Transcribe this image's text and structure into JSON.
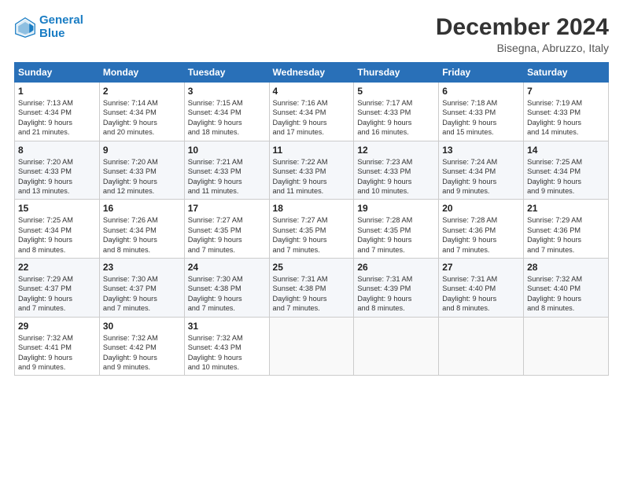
{
  "header": {
    "logo_line1": "General",
    "logo_line2": "Blue",
    "month": "December 2024",
    "location": "Bisegna, Abruzzo, Italy"
  },
  "weekdays": [
    "Sunday",
    "Monday",
    "Tuesday",
    "Wednesday",
    "Thursday",
    "Friday",
    "Saturday"
  ],
  "weeks": [
    [
      {
        "day": "1",
        "info": "Sunrise: 7:13 AM\nSunset: 4:34 PM\nDaylight: 9 hours\nand 21 minutes."
      },
      {
        "day": "2",
        "info": "Sunrise: 7:14 AM\nSunset: 4:34 PM\nDaylight: 9 hours\nand 20 minutes."
      },
      {
        "day": "3",
        "info": "Sunrise: 7:15 AM\nSunset: 4:34 PM\nDaylight: 9 hours\nand 18 minutes."
      },
      {
        "day": "4",
        "info": "Sunrise: 7:16 AM\nSunset: 4:34 PM\nDaylight: 9 hours\nand 17 minutes."
      },
      {
        "day": "5",
        "info": "Sunrise: 7:17 AM\nSunset: 4:33 PM\nDaylight: 9 hours\nand 16 minutes."
      },
      {
        "day": "6",
        "info": "Sunrise: 7:18 AM\nSunset: 4:33 PM\nDaylight: 9 hours\nand 15 minutes."
      },
      {
        "day": "7",
        "info": "Sunrise: 7:19 AM\nSunset: 4:33 PM\nDaylight: 9 hours\nand 14 minutes."
      }
    ],
    [
      {
        "day": "8",
        "info": "Sunrise: 7:20 AM\nSunset: 4:33 PM\nDaylight: 9 hours\nand 13 minutes."
      },
      {
        "day": "9",
        "info": "Sunrise: 7:20 AM\nSunset: 4:33 PM\nDaylight: 9 hours\nand 12 minutes."
      },
      {
        "day": "10",
        "info": "Sunrise: 7:21 AM\nSunset: 4:33 PM\nDaylight: 9 hours\nand 11 minutes."
      },
      {
        "day": "11",
        "info": "Sunrise: 7:22 AM\nSunset: 4:33 PM\nDaylight: 9 hours\nand 11 minutes."
      },
      {
        "day": "12",
        "info": "Sunrise: 7:23 AM\nSunset: 4:33 PM\nDaylight: 9 hours\nand 10 minutes."
      },
      {
        "day": "13",
        "info": "Sunrise: 7:24 AM\nSunset: 4:34 PM\nDaylight: 9 hours\nand 9 minutes."
      },
      {
        "day": "14",
        "info": "Sunrise: 7:25 AM\nSunset: 4:34 PM\nDaylight: 9 hours\nand 9 minutes."
      }
    ],
    [
      {
        "day": "15",
        "info": "Sunrise: 7:25 AM\nSunset: 4:34 PM\nDaylight: 9 hours\nand 8 minutes."
      },
      {
        "day": "16",
        "info": "Sunrise: 7:26 AM\nSunset: 4:34 PM\nDaylight: 9 hours\nand 8 minutes."
      },
      {
        "day": "17",
        "info": "Sunrise: 7:27 AM\nSunset: 4:35 PM\nDaylight: 9 hours\nand 7 minutes."
      },
      {
        "day": "18",
        "info": "Sunrise: 7:27 AM\nSunset: 4:35 PM\nDaylight: 9 hours\nand 7 minutes."
      },
      {
        "day": "19",
        "info": "Sunrise: 7:28 AM\nSunset: 4:35 PM\nDaylight: 9 hours\nand 7 minutes."
      },
      {
        "day": "20",
        "info": "Sunrise: 7:28 AM\nSunset: 4:36 PM\nDaylight: 9 hours\nand 7 minutes."
      },
      {
        "day": "21",
        "info": "Sunrise: 7:29 AM\nSunset: 4:36 PM\nDaylight: 9 hours\nand 7 minutes."
      }
    ],
    [
      {
        "day": "22",
        "info": "Sunrise: 7:29 AM\nSunset: 4:37 PM\nDaylight: 9 hours\nand 7 minutes."
      },
      {
        "day": "23",
        "info": "Sunrise: 7:30 AM\nSunset: 4:37 PM\nDaylight: 9 hours\nand 7 minutes."
      },
      {
        "day": "24",
        "info": "Sunrise: 7:30 AM\nSunset: 4:38 PM\nDaylight: 9 hours\nand 7 minutes."
      },
      {
        "day": "25",
        "info": "Sunrise: 7:31 AM\nSunset: 4:38 PM\nDaylight: 9 hours\nand 7 minutes."
      },
      {
        "day": "26",
        "info": "Sunrise: 7:31 AM\nSunset: 4:39 PM\nDaylight: 9 hours\nand 8 minutes."
      },
      {
        "day": "27",
        "info": "Sunrise: 7:31 AM\nSunset: 4:40 PM\nDaylight: 9 hours\nand 8 minutes."
      },
      {
        "day": "28",
        "info": "Sunrise: 7:32 AM\nSunset: 4:40 PM\nDaylight: 9 hours\nand 8 minutes."
      }
    ],
    [
      {
        "day": "29",
        "info": "Sunrise: 7:32 AM\nSunset: 4:41 PM\nDaylight: 9 hours\nand 9 minutes."
      },
      {
        "day": "30",
        "info": "Sunrise: 7:32 AM\nSunset: 4:42 PM\nDaylight: 9 hours\nand 9 minutes."
      },
      {
        "day": "31",
        "info": "Sunrise: 7:32 AM\nSunset: 4:43 PM\nDaylight: 9 hours\nand 10 minutes."
      },
      {
        "day": "",
        "info": ""
      },
      {
        "day": "",
        "info": ""
      },
      {
        "day": "",
        "info": ""
      },
      {
        "day": "",
        "info": ""
      }
    ]
  ]
}
